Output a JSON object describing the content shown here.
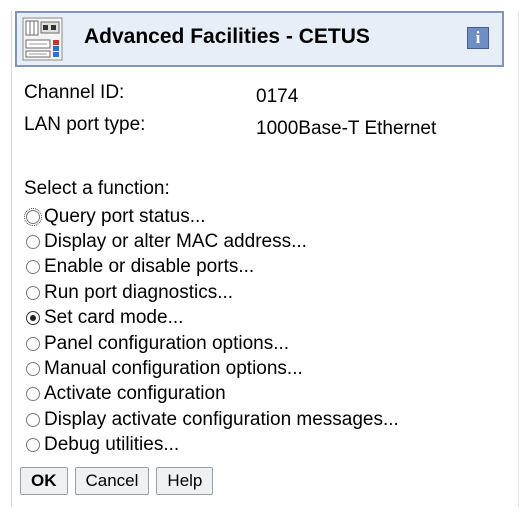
{
  "window": {
    "title": "Advanced Facilities - CETUS",
    "app_icon": "hardware-panel-icon",
    "info_label": "i"
  },
  "details": {
    "channel_id_label": "Channel ID:",
    "channel_id_value": "0174",
    "lan_port_label": "LAN port type:",
    "lan_port_value": "1000Base-T Ethernet"
  },
  "function": {
    "label": "Select a function:",
    "selected_index": 4,
    "options": [
      {
        "label": "Query port status..."
      },
      {
        "label": "Display or alter MAC address..."
      },
      {
        "label": "Enable or disable ports..."
      },
      {
        "label": "Run port diagnostics..."
      },
      {
        "label": "Set card mode..."
      },
      {
        "label": "Panel configuration options..."
      },
      {
        "label": "Manual configuration options..."
      },
      {
        "label": "Activate configuration"
      },
      {
        "label": "Display activate configuration messages..."
      },
      {
        "label": "Debug utilities..."
      }
    ]
  },
  "buttons": {
    "ok": "OK",
    "cancel": "Cancel",
    "help": "Help"
  },
  "colors": {
    "title_bg": "#e8eef7",
    "title_border": "#7d95bf",
    "info_button": "#6f8fc4"
  }
}
